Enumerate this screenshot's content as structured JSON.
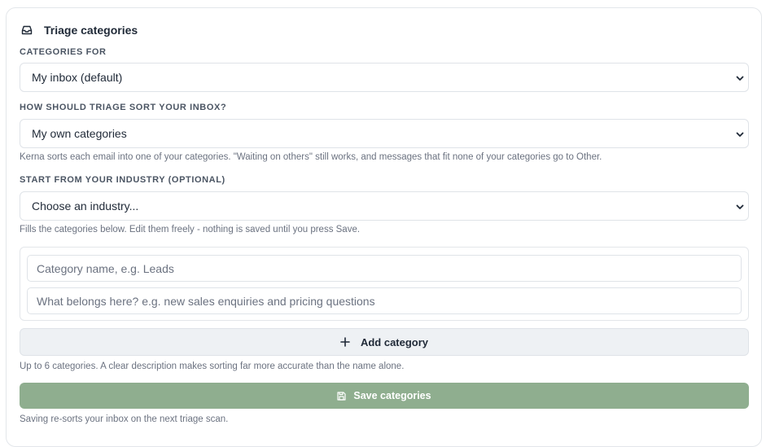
{
  "header": {
    "title": "Triage categories",
    "icon": "inbox-icon"
  },
  "categories_for": {
    "label": "CATEGORIES FOR",
    "selected": "My inbox (default)"
  },
  "sort_mode": {
    "label": "HOW SHOULD TRIAGE SORT YOUR INBOX?",
    "selected": "My own categories",
    "help": "Kerna sorts each email into one of your categories. \"Waiting on others\" still works, and messages that fit none of your categories go to Other."
  },
  "industry": {
    "label": "START FROM YOUR INDUSTRY (OPTIONAL)",
    "selected": "Choose an industry...",
    "help": "Fills the categories below. Edit them freely - nothing is saved until you press Save."
  },
  "category_editor": {
    "name_placeholder": "Category name, e.g. Leads",
    "description_placeholder": "What belongs here? e.g. new sales enquiries and pricing questions"
  },
  "add_category": {
    "label": "Add category",
    "help": "Up to 6 categories. A clear description makes sorting far more accurate than the name alone."
  },
  "save": {
    "label": "Save categories",
    "help": "Saving re-sorts your inbox on the next triage scan.",
    "color": "#8fae8f"
  }
}
